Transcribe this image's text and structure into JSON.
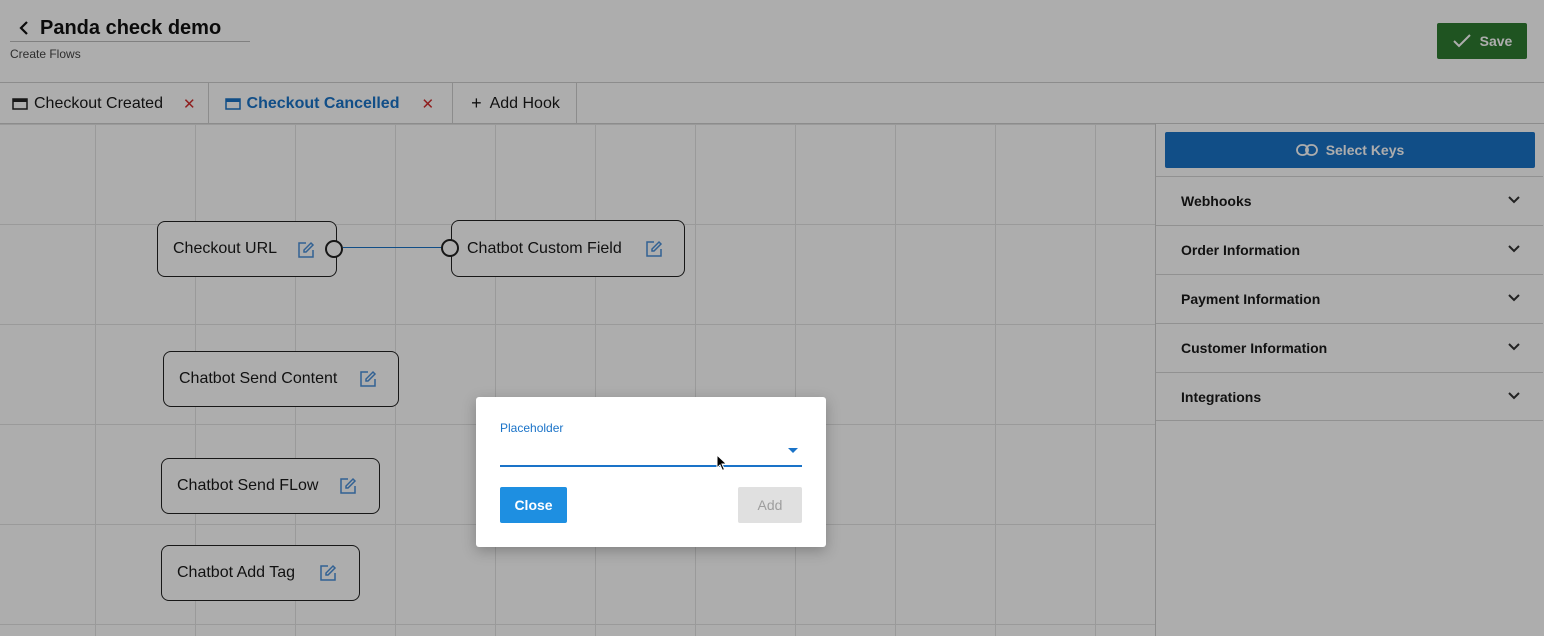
{
  "header": {
    "title": "Panda check demo",
    "subtitle": "Create Flows",
    "save_label": "Save"
  },
  "tabs": [
    {
      "label": "Checkout Created",
      "icon": "folder-icon",
      "active": false
    },
    {
      "label": "Checkout Cancelled",
      "icon": "folder-icon",
      "active": true
    },
    {
      "label": "Add Hook",
      "icon": "plus-icon"
    }
  ],
  "canvas": {
    "nodes": [
      {
        "label": "Checkout URL"
      },
      {
        "label": "Chatbot Custom Field"
      },
      {
        "label": "Chatbot Send Content"
      },
      {
        "label": "Chatbot Send FLow"
      },
      {
        "label": "Chatbot Add Tag"
      }
    ]
  },
  "panel": {
    "select_keys_label": "Select Keys",
    "sections": [
      {
        "label": "Webhooks"
      },
      {
        "label": "Order Information"
      },
      {
        "label": "Payment Information"
      },
      {
        "label": "Customer Information"
      },
      {
        "label": "Integrations"
      }
    ]
  },
  "dialog": {
    "field_label": "Placeholder",
    "field_value": "",
    "close_label": "Close",
    "add_label": "Add"
  },
  "colors": {
    "accent": "#1a73c8",
    "save": "#2e7d32",
    "danger": "#d32f2f"
  }
}
